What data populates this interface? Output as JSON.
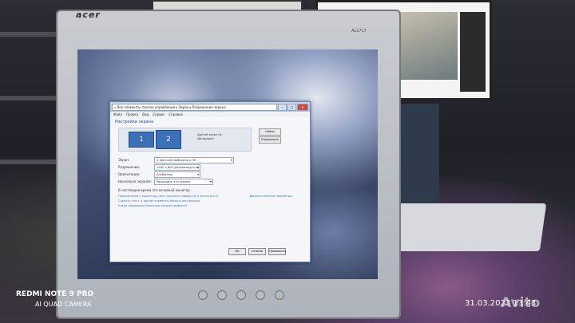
{
  "monitor": {
    "brand": "acer",
    "model": "AL1717"
  },
  "window": {
    "breadcrumb": "« Все элементы панели управления ▸ Экран ▸ Разрешение экрана",
    "menu": [
      "Файл",
      "Правка",
      "Вид",
      "Сервис",
      "Справка"
    ],
    "heading": "Настройки экрана",
    "display_1": "1",
    "display_2": "2",
    "detect_hint": "Другой экран не обнаружен",
    "find_button": "Найти",
    "identify_button": "Определить",
    "rows": [
      {
        "label": "Экран:",
        "value": "2. Дисплей мобильного ПК"
      },
      {
        "label": "Разрешение:",
        "value": "1280 × 800 (рекомендуется)"
      },
      {
        "label": "Ориентация:",
        "value": "Альбомная"
      },
      {
        "label": "Несколько экранов:",
        "value": "Расширить эти экраны"
      }
    ],
    "main_display_note": "В настоящее время это основной монитор",
    "advanced_link": "Дополнительные параметры",
    "links": [
      "Подключение к проектору (или нажмите клавишу ⊞ и коснитесь P)",
      "Сделать текст и другие элементы больше или меньше",
      "Какие параметры монитора следует выбрать?"
    ],
    "ok_button": "ОК",
    "cancel_button": "Отмена",
    "apply_button": "Применить"
  },
  "watermark": {
    "line1": "REDMI NOTE 9 PRO",
    "line2": "AI QUAD CAMERA",
    "datetime": "31.03.2023  13:43",
    "site": "Avito"
  }
}
